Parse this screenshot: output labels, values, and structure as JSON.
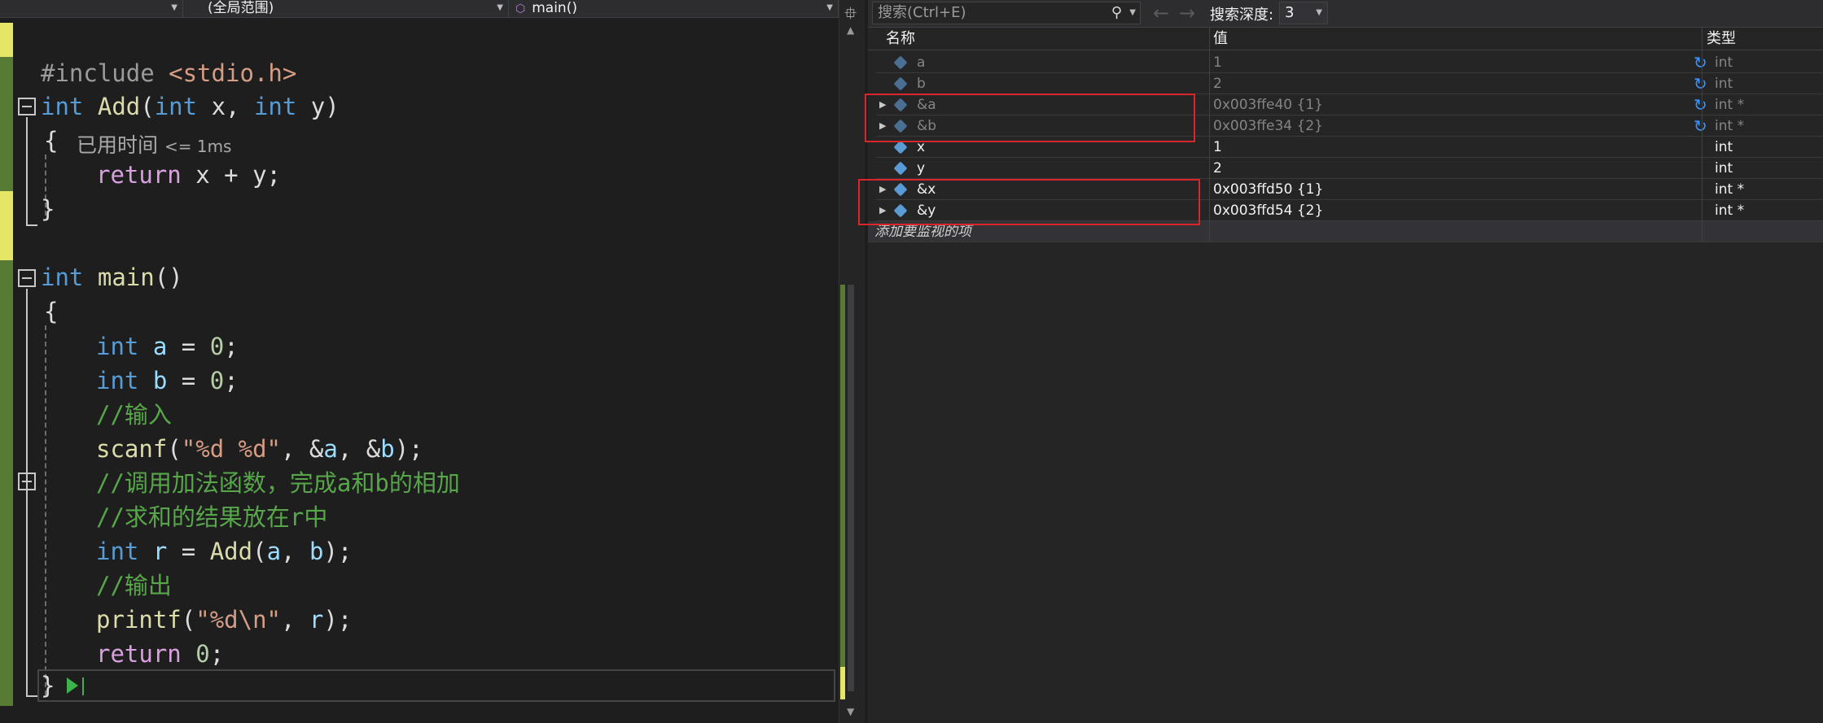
{
  "editor": {
    "nav": {
      "scope_partial": "",
      "scope_label": "(全局范围)",
      "function_label": "main()"
    },
    "code": [
      {
        "parts": [
          [
            "pp",
            "#include "
          ],
          [
            "str",
            "<stdio.h>"
          ]
        ]
      },
      {
        "parts": [
          [
            "kw",
            "int"
          ],
          [
            "plain",
            " "
          ],
          [
            "fn",
            "Add"
          ],
          [
            "plain",
            "("
          ],
          [
            "kw",
            "int"
          ],
          [
            "plain",
            " x, "
          ],
          [
            "kw",
            "int"
          ],
          [
            "plain",
            " y)"
          ]
        ]
      },
      {
        "parts": [
          [
            "plain",
            "{"
          ]
        ]
      },
      {
        "parts": [
          [
            "kw2",
            "return"
          ],
          [
            "plain",
            " x + y;"
          ]
        ]
      },
      {
        "parts": [
          [
            "plain",
            "}"
          ]
        ]
      },
      {
        "parts": [
          [
            "kw",
            "int"
          ],
          [
            "plain",
            " "
          ],
          [
            "fn",
            "main"
          ],
          [
            "plain",
            "()"
          ]
        ]
      },
      {
        "parts": [
          [
            "plain",
            "{"
          ]
        ]
      },
      {
        "parts": [
          [
            "kw",
            "int"
          ],
          [
            "plain",
            " "
          ],
          [
            "var",
            "a"
          ],
          [
            "plain",
            " = "
          ],
          [
            "num",
            "0"
          ],
          [
            "plain",
            ";"
          ]
        ]
      },
      {
        "parts": [
          [
            "kw",
            "int"
          ],
          [
            "plain",
            " "
          ],
          [
            "var",
            "b"
          ],
          [
            "plain",
            " = "
          ],
          [
            "num",
            "0"
          ],
          [
            "plain",
            ";"
          ]
        ]
      },
      {
        "parts": [
          [
            "cmt",
            "//输入"
          ]
        ]
      },
      {
        "parts": [
          [
            "fn",
            "scanf"
          ],
          [
            "plain",
            "("
          ],
          [
            "str",
            "\"%d %d\""
          ],
          [
            "plain",
            ", &"
          ],
          [
            "var",
            "a"
          ],
          [
            "plain",
            ", &"
          ],
          [
            "var",
            "b"
          ],
          [
            "plain",
            ");"
          ]
        ]
      },
      {
        "parts": [
          [
            "cmt",
            "//调用加法函数，完成a和b的相加"
          ]
        ]
      },
      {
        "parts": [
          [
            "cmt",
            "//求和的结果放在r中"
          ]
        ]
      },
      {
        "parts": [
          [
            "kw",
            "int"
          ],
          [
            "plain",
            " "
          ],
          [
            "var",
            "r"
          ],
          [
            "plain",
            " = "
          ],
          [
            "fn",
            "Add"
          ],
          [
            "plain",
            "("
          ],
          [
            "var",
            "a"
          ],
          [
            "plain",
            ", "
          ],
          [
            "var",
            "b"
          ],
          [
            "plain",
            ");"
          ]
        ]
      },
      {
        "parts": [
          [
            "cmt",
            "//输出"
          ]
        ]
      },
      {
        "parts": [
          [
            "fn",
            "printf"
          ],
          [
            "plain",
            "("
          ],
          [
            "str",
            "\"%d\\n\""
          ],
          [
            "plain",
            ", "
          ],
          [
            "var",
            "r"
          ],
          [
            "plain",
            ");"
          ]
        ]
      },
      {
        "parts": [
          [
            "kw2",
            "return"
          ],
          [
            "plain",
            " "
          ],
          [
            "num",
            "0"
          ],
          [
            "plain",
            ";"
          ]
        ]
      },
      {
        "parts": [
          [
            "plain",
            "}"
          ]
        ]
      }
    ],
    "elapsed_hint": {
      "label": "已用时间",
      "value": "<= 1ms"
    }
  },
  "watch": {
    "search_placeholder": "搜索(Ctrl+E)",
    "depth_label": "搜索深度:",
    "depth_value": "3",
    "columns": {
      "name": "名称",
      "value": "值",
      "type": "类型"
    },
    "rows": [
      {
        "name": "a",
        "value": "1",
        "type": "int",
        "state": "stale",
        "expandable": false
      },
      {
        "name": "b",
        "value": "2",
        "type": "int",
        "state": "stale",
        "expandable": false
      },
      {
        "name": "&a",
        "value": "0x003ffe40 {1}",
        "type": "int *",
        "state": "stale",
        "expandable": true
      },
      {
        "name": "&b",
        "value": "0x003ffe34 {2}",
        "type": "int *",
        "state": "stale",
        "expandable": true
      },
      {
        "name": "x",
        "value": "1",
        "type": "int",
        "state": "fresh",
        "expandable": false
      },
      {
        "name": "y",
        "value": "2",
        "type": "int",
        "state": "fresh",
        "expandable": false
      },
      {
        "name": "&x",
        "value": "0x003ffd50 {1}",
        "type": "int *",
        "state": "fresh",
        "expandable": true
      },
      {
        "name": "&y",
        "value": "0x003ffd54 {2}",
        "type": "int *",
        "state": "fresh",
        "expandable": true
      }
    ],
    "add_item_label": "添加要监视的项"
  },
  "colors": {
    "highlight_box": "#d9262b",
    "keyword": "#569cd6",
    "comment": "#57a64a",
    "string": "#d69d85",
    "function": "#dcdcaa"
  }
}
